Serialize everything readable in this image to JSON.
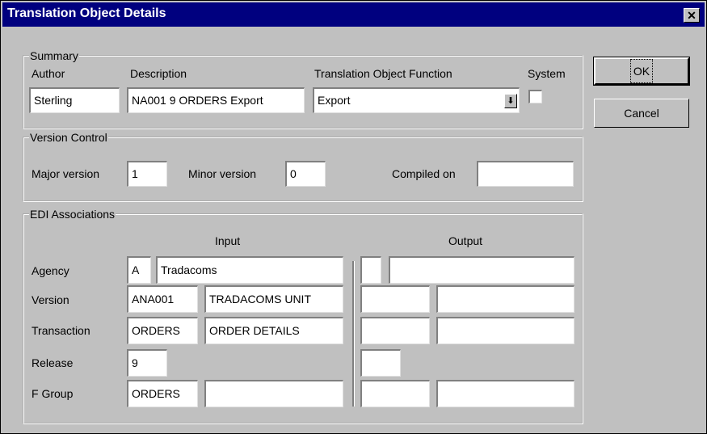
{
  "window": {
    "title": "Translation Object Details",
    "close_label": "✕"
  },
  "summary": {
    "legend": "Summary",
    "author_label": "Author",
    "author_value": "Sterling",
    "description_label": "Description",
    "description_value": "NA001 9 ORDERS Export",
    "function_label": "Translation Object Function",
    "function_value": "Export",
    "system_label": "System"
  },
  "version_control": {
    "legend": "Version Control",
    "major_label": "Major version",
    "major_value": "1",
    "minor_label": "Minor version",
    "minor_value": "0",
    "compiled_label": "Compiled on",
    "compiled_value": ""
  },
  "edi": {
    "legend": "EDI Associations",
    "input_header": "Input",
    "output_header": "Output",
    "rows": [
      {
        "label": "Agency",
        "input_code": "A",
        "input_desc": "Tradacoms"
      },
      {
        "label": "Version",
        "input_code": "ANA001",
        "input_desc": "TRADACOMS UNIT"
      },
      {
        "label": "Transaction",
        "input_code": "ORDERS",
        "input_desc": "ORDER DETAILS"
      },
      {
        "label": "Release",
        "input_code": "9"
      },
      {
        "label": "F Group",
        "input_code": "ORDERS",
        "input_desc": ""
      }
    ]
  },
  "buttons": {
    "ok": "OK",
    "cancel": "Cancel"
  }
}
